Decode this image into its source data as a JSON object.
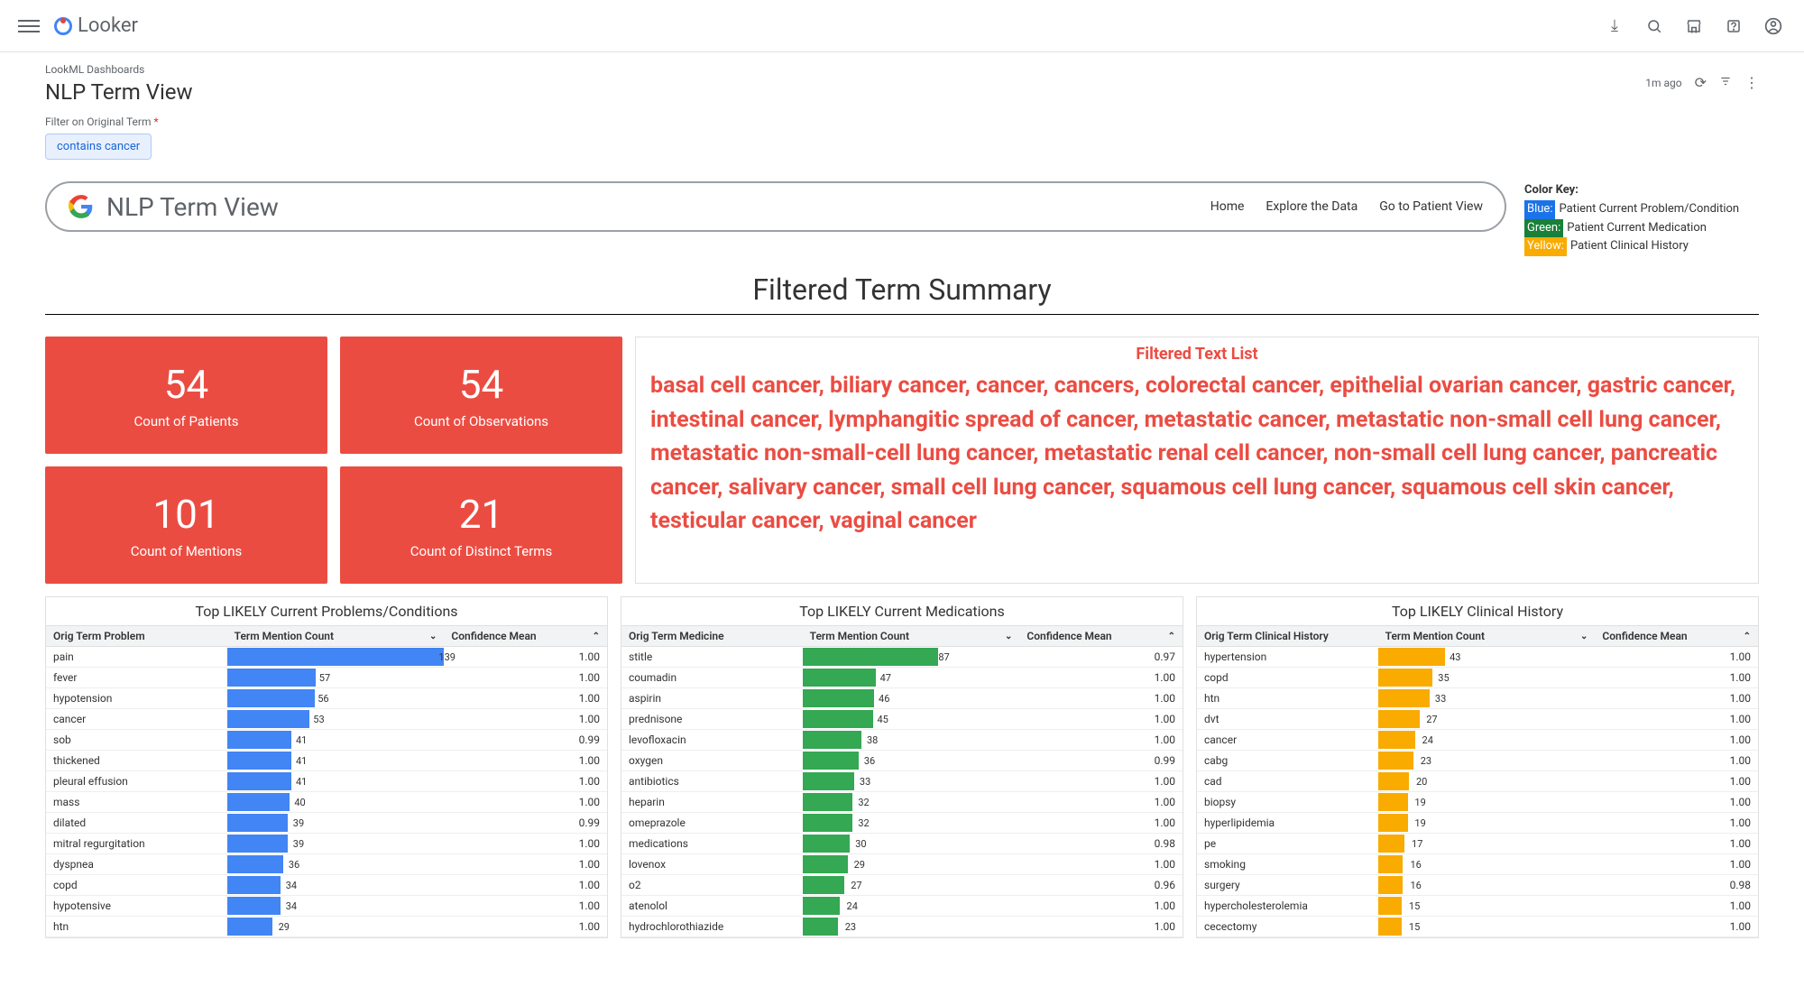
{
  "header": {
    "logo_text": "Looker",
    "breadcrumb": "LookML Dashboards",
    "title": "NLP Term View",
    "time_ago": "1m ago"
  },
  "filter": {
    "label": "Filter on Original Term",
    "chip": "contains cancer"
  },
  "search": {
    "title": "NLP Term View",
    "links": {
      "home": "Home",
      "explore": "Explore the Data",
      "patient": "Go to Patient View"
    }
  },
  "color_key": {
    "title": "Color Key:",
    "blue_label": "Blue:",
    "blue_text": "Patient Current Problem/Condition",
    "green_label": "Green:",
    "green_text": "Patient Current Medication",
    "yellow_label": "Yellow:",
    "yellow_text": "Patient Clinical History"
  },
  "section_title": "Filtered Term Summary",
  "kpi": {
    "patients": {
      "value": "54",
      "label": "Count of Patients"
    },
    "observations": {
      "value": "54",
      "label": "Count of Observations"
    },
    "mentions": {
      "value": "101",
      "label": "Count of Mentions"
    },
    "distinct": {
      "value": "21",
      "label": "Count of Distinct Terms"
    }
  },
  "text_list": {
    "title": "Filtered Text List",
    "body": "basal cell cancer, biliary cancer, cancer, cancers, colorectal cancer, epithelial ovarian cancer, gastric cancer, intestinal cancer, lymphangitic spread of cancer, metastatic cancer, metastatic non-small cell lung cancer, metastatic non-small-cell lung cancer, metastatic renal cell cancer, non-small cell lung cancer, pancreatic cancer, salivary cancer, small cell lung cancer, squamous cell lung cancer, squamous cell skin cancer, testicular cancer, vaginal cancer"
  },
  "tables": {
    "problems": {
      "title": "Top LIKELY Current Problems/Conditions",
      "col1": "Orig Term Problem",
      "col2": "Term Mention Count",
      "col3": "Confidence Mean",
      "max": 139,
      "rows": [
        {
          "term": "pain",
          "count": 139,
          "conf": "1.00"
        },
        {
          "term": "fever",
          "count": 57,
          "conf": "1.00"
        },
        {
          "term": "hypotension",
          "count": 56,
          "conf": "1.00"
        },
        {
          "term": "cancer",
          "count": 53,
          "conf": "1.00"
        },
        {
          "term": "sob",
          "count": 41,
          "conf": "0.99"
        },
        {
          "term": "thickened",
          "count": 41,
          "conf": "1.00"
        },
        {
          "term": "pleural effusion",
          "count": 41,
          "conf": "1.00"
        },
        {
          "term": "mass",
          "count": 40,
          "conf": "1.00"
        },
        {
          "term": "dilated",
          "count": 39,
          "conf": "0.99"
        },
        {
          "term": "mitral regurgitation",
          "count": 39,
          "conf": "1.00"
        },
        {
          "term": "dyspnea",
          "count": 36,
          "conf": "1.00"
        },
        {
          "term": "copd",
          "count": 34,
          "conf": "1.00"
        },
        {
          "term": "hypotensive",
          "count": 34,
          "conf": "1.00"
        },
        {
          "term": "htn",
          "count": 29,
          "conf": "1.00"
        }
      ]
    },
    "medications": {
      "title": "Top LIKELY Current Medications",
      "col1": "Orig Term Medicine",
      "col2": "Term Mention Count",
      "col3": "Confidence Mean",
      "max": 139,
      "rows": [
        {
          "term": "stitle",
          "count": 87,
          "conf": "0.97"
        },
        {
          "term": "coumadin",
          "count": 47,
          "conf": "1.00"
        },
        {
          "term": "aspirin",
          "count": 46,
          "conf": "1.00"
        },
        {
          "term": "prednisone",
          "count": 45,
          "conf": "1.00"
        },
        {
          "term": "levofloxacin",
          "count": 38,
          "conf": "1.00"
        },
        {
          "term": "oxygen",
          "count": 36,
          "conf": "0.99"
        },
        {
          "term": "antibiotics",
          "count": 33,
          "conf": "1.00"
        },
        {
          "term": "heparin",
          "count": 32,
          "conf": "1.00"
        },
        {
          "term": "omeprazole",
          "count": 32,
          "conf": "1.00"
        },
        {
          "term": "medications",
          "count": 30,
          "conf": "0.98"
        },
        {
          "term": "lovenox",
          "count": 29,
          "conf": "1.00"
        },
        {
          "term": "o2",
          "count": 27,
          "conf": "0.96"
        },
        {
          "term": "atenolol",
          "count": 24,
          "conf": "1.00"
        },
        {
          "term": "hydrochlorothiazide",
          "count": 23,
          "conf": "1.00"
        }
      ]
    },
    "history": {
      "title": "Top LIKELY Clinical History",
      "col1": "Orig Term Clinical History",
      "col2": "Term Mention Count",
      "col3": "Confidence Mean",
      "max": 139,
      "rows": [
        {
          "term": "hypertension",
          "count": 43,
          "conf": "1.00"
        },
        {
          "term": "copd",
          "count": 35,
          "conf": "1.00"
        },
        {
          "term": "htn",
          "count": 33,
          "conf": "1.00"
        },
        {
          "term": "dvt",
          "count": 27,
          "conf": "1.00"
        },
        {
          "term": "cancer",
          "count": 24,
          "conf": "1.00"
        },
        {
          "term": "cabg",
          "count": 23,
          "conf": "1.00"
        },
        {
          "term": "cad",
          "count": 20,
          "conf": "1.00"
        },
        {
          "term": "biopsy",
          "count": 19,
          "conf": "1.00"
        },
        {
          "term": "hyperlipidemia",
          "count": 19,
          "conf": "1.00"
        },
        {
          "term": "pe",
          "count": 17,
          "conf": "1.00"
        },
        {
          "term": "smoking",
          "count": 16,
          "conf": "1.00"
        },
        {
          "term": "surgery",
          "count": 16,
          "conf": "0.98"
        },
        {
          "term": "hypercholesterolemia",
          "count": 15,
          "conf": "1.00"
        },
        {
          "term": "cecectomy",
          "count": 15,
          "conf": "1.00"
        }
      ]
    }
  },
  "chart_data": [
    {
      "type": "bar",
      "title": "Top LIKELY Current Problems/Conditions — Term Mention Count",
      "categories": [
        "pain",
        "fever",
        "hypotension",
        "cancer",
        "sob",
        "thickened",
        "pleural effusion",
        "mass",
        "dilated",
        "mitral regurgitation",
        "dyspnea",
        "copd",
        "hypotensive",
        "htn"
      ],
      "values": [
        139,
        57,
        56,
        53,
        41,
        41,
        41,
        40,
        39,
        39,
        36,
        34,
        34,
        29
      ],
      "xlabel": "Term Mention Count",
      "ylabel": "Orig Term Problem",
      "xlim": [
        0,
        139
      ]
    },
    {
      "type": "bar",
      "title": "Top LIKELY Current Medications — Term Mention Count",
      "categories": [
        "stitle",
        "coumadin",
        "aspirin",
        "prednisone",
        "levofloxacin",
        "oxygen",
        "antibiotics",
        "heparin",
        "omeprazole",
        "medications",
        "lovenox",
        "o2",
        "atenolol",
        "hydrochlorothiazide"
      ],
      "values": [
        87,
        47,
        46,
        45,
        38,
        36,
        33,
        32,
        32,
        30,
        29,
        27,
        24,
        23
      ],
      "xlabel": "Term Mention Count",
      "ylabel": "Orig Term Medicine",
      "xlim": [
        0,
        139
      ]
    },
    {
      "type": "bar",
      "title": "Top LIKELY Clinical History — Term Mention Count",
      "categories": [
        "hypertension",
        "copd",
        "htn",
        "dvt",
        "cancer",
        "cabg",
        "cad",
        "biopsy",
        "hyperlipidemia",
        "pe",
        "smoking",
        "surgery",
        "hypercholesterolemia",
        "cecectomy"
      ],
      "values": [
        43,
        35,
        33,
        27,
        24,
        23,
        20,
        19,
        19,
        17,
        16,
        16,
        15,
        15
      ],
      "xlabel": "Term Mention Count",
      "ylabel": "Orig Term Clinical History",
      "xlim": [
        0,
        139
      ]
    }
  ]
}
